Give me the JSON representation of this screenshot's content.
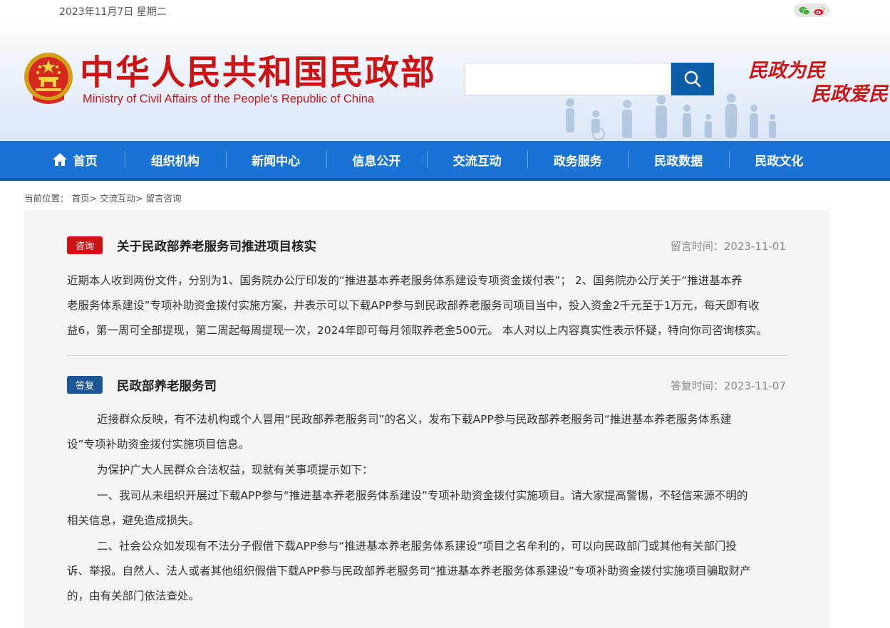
{
  "topbar": {
    "date": "2023年11月7日 星期二",
    "social_icons": [
      "wechat-icon",
      "weibo-icon"
    ]
  },
  "header": {
    "title_cn": "中华人民共和国民政部",
    "title_en": "Ministry of Civil Affairs of the People's Republic of China",
    "search_placeholder": "",
    "slogan_line1": "民政为民",
    "slogan_line2": "民政爱民"
  },
  "nav": {
    "items": [
      {
        "label": "首页",
        "icon": "home-icon"
      },
      {
        "label": "组织机构"
      },
      {
        "label": "新闻中心"
      },
      {
        "label": "信息公开"
      },
      {
        "label": "交流互动"
      },
      {
        "label": "政务服务"
      },
      {
        "label": "民政数据"
      },
      {
        "label": "民政文化"
      }
    ]
  },
  "breadcrumb": {
    "prefix": "当前位置：",
    "items": [
      "首页>",
      "交流互动>",
      "留言咨询"
    ]
  },
  "inquiry": {
    "tag": "咨询",
    "title": "关于民政部养老服务司推进项目核实",
    "time": "留言时间：2023-11-01",
    "lines": [
      "近期本人收到两份文件，分别为1、国务院办公厅印发的“推进基本养老服务体系建设专项资金拨付表”； 2、国务院办公厅关于“推进基本养",
      "老服务体系建设”专项补助资金拨付实施方案，并表示可以下载APP参与到民政部养老服务司项目当中，投入资金2千元至于1万元，每天即有收",
      "益6，第一周可全部提现，第二周起每周提现一次，2024年即可每月领取养老金500元。 本人对以上内容真实性表示怀疑，特向你司咨询核实。"
    ]
  },
  "reply": {
    "tag": "答复",
    "title": "民政部养老服务司",
    "time": "答复时间：2023-11-07",
    "lines": [
      "近接群众反映，有不法机构或个人冒用“民政部养老服务司”的名义，发布下载APP参与民政部养老服务司“推进基本养老服务体系建",
      "设”专项补助资金拨付实施项目信息。",
      "为保护广大人民群众合法权益，现就有关事项提示如下：",
      "一、我司从未组织开展过下载APP参与“推进基本养老服务体系建设”专项补助资金拨付实施项目。请大家提高警惕，不轻信来源不明的",
      "相关信息，避免造成损失。",
      "二、社会公众如发现有不法分子假借下载APP参与“推进基本养老服务体系建设”项目之名牟利的，可以向民政部门或其他有关部门投",
      "诉、举报。自然人、法人或者其他组织假借下载APP参与民政部养老服务司“推进基本养老服务体系建设”专项补助资金拨付实施项目骗取财产",
      "的，由有关部门依法查处。"
    ]
  },
  "colors": {
    "brand_red": "#cc1414",
    "nav_blue": "#1a73d4",
    "search_blue": "#0d5ea8",
    "reply_tag_blue": "#1b5797"
  }
}
